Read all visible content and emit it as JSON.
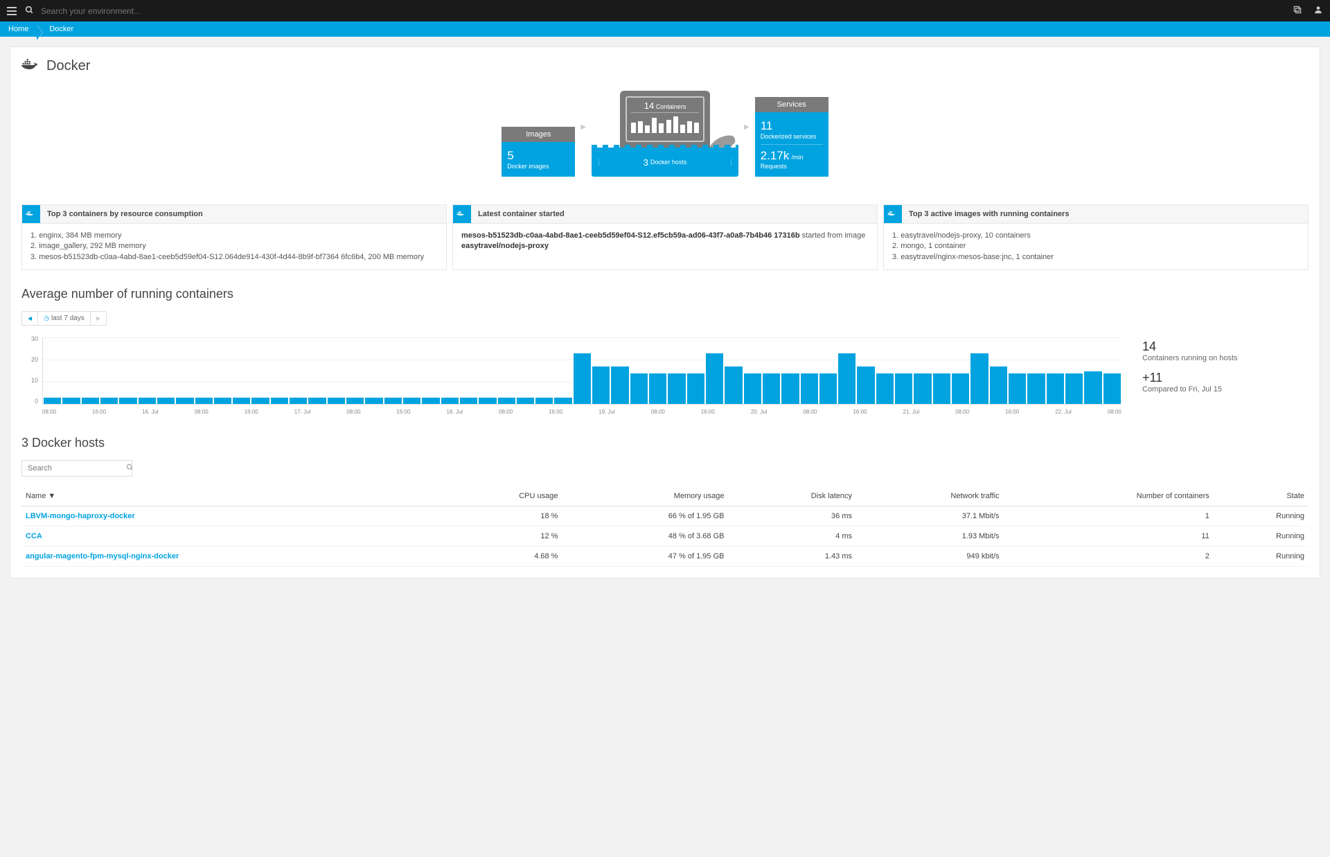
{
  "topbar": {
    "search_placeholder": "Search your environment..."
  },
  "breadcrumb": {
    "home": "Home",
    "current": "Docker"
  },
  "page": {
    "title": "Docker"
  },
  "cards": {
    "images": {
      "header": "Images",
      "count": "5",
      "label": "Docker images"
    },
    "containers": {
      "count": "14",
      "label": "Containers",
      "hosts_count": "3",
      "hosts_label": "Docker hosts"
    },
    "services": {
      "header": "Services",
      "count": "11",
      "label": "Dockerized services",
      "rate": "2.17k",
      "rate_unit": "/min",
      "rate_label": "Requests"
    }
  },
  "panels": {
    "top_containers": {
      "title": "Top 3 containers by resource consumption",
      "items": [
        "1. enginx, 384 MB memory",
        "2. image_gallery, 292 MB memory",
        "3. mesos-b51523db-c0aa-4abd-8ae1-ceeb5d59ef04-S12.064de914-430f-4d44-8b9f-bf7364 6fc6b4, 200 MB memory"
      ]
    },
    "latest": {
      "title": "Latest container started",
      "bold1": "mesos-b51523db-c0aa-4abd-8ae1-ceeb5d59ef04-S12.ef5cb59a-ad06-43f7-a0a8-7b4b46 17316b",
      "text": " started from image ",
      "bold2": "easytravel/nodejs-proxy"
    },
    "top_images": {
      "title": "Top 3 active images with running containers",
      "items": [
        "1. easytravel/nodejs-proxy, 10 containers",
        "2. mongo, 1 container",
        "3. easytravel/nginx-mesos-base:jnc, 1 container"
      ]
    }
  },
  "chart_section": {
    "title": "Average number of running containers",
    "timerange": "last 7 days",
    "summary": {
      "count": "14",
      "count_label": "Containers running on hosts",
      "delta": "+11",
      "delta_label": "Compared to Fri, Jul 15"
    }
  },
  "chart_data": {
    "type": "bar",
    "title": "Average number of running containers",
    "ylabel": "",
    "xlabel": "",
    "ylim": [
      0,
      30
    ],
    "yticks": [
      0,
      10,
      20,
      30
    ],
    "categories": [
      "08:00",
      "",
      "16:00",
      "",
      "16. Jul",
      "",
      "08:00",
      "",
      "16:00",
      "",
      "17. Jul",
      "",
      "08:00",
      "",
      "16:00",
      "",
      "18. Jul",
      "",
      "08:00",
      "",
      "16:00",
      "",
      "19. Jul",
      "",
      "08:00",
      "",
      "16:00",
      "",
      "20. Jul",
      "",
      "08:00",
      "",
      "16:00",
      "",
      "21. Jul",
      "",
      "08:00",
      "",
      "16:00",
      "",
      "22. Jul",
      "",
      "08:00"
    ],
    "x_axis_labels": [
      "08:00",
      "16:00",
      "16. Jul",
      "08:00",
      "16:00",
      "17. Jul",
      "08:00",
      "16:00",
      "18. Jul",
      "08:00",
      "16:00",
      "19. Jul",
      "08:00",
      "16:00",
      "20. Jul",
      "08:00",
      "16:00",
      "21. Jul",
      "08:00",
      "16:00",
      "22. Jul",
      "08:00"
    ],
    "values": [
      3,
      3,
      3,
      3,
      3,
      3,
      3,
      3,
      3,
      3,
      3,
      3,
      3,
      3,
      3,
      3,
      3,
      3,
      3,
      3,
      3,
      3,
      3,
      3,
      3,
      3,
      3,
      3,
      23,
      17,
      17,
      14,
      14,
      14,
      14,
      23,
      17,
      14,
      14,
      14,
      14,
      14,
      23,
      17,
      14,
      14,
      14,
      14,
      14,
      23,
      17,
      14,
      14,
      14,
      14,
      15,
      14
    ]
  },
  "hosts": {
    "title": "3 Docker hosts",
    "search_placeholder": "Search",
    "columns": [
      "Name ▼",
      "CPU usage",
      "Memory usage",
      "Disk latency",
      "Network traffic",
      "Number of containers",
      "State"
    ],
    "rows": [
      {
        "name": "LBVM-mongo-haproxy-docker",
        "cpu": "18 %",
        "mem": "66 % of 1.95 GB",
        "disk": "36 ms",
        "net": "37.1 Mbit/s",
        "cnt": "1",
        "state": "Running"
      },
      {
        "name": "CCA",
        "cpu": "12 %",
        "mem": "48 % of 3.68 GB",
        "disk": "4 ms",
        "net": "1.93 Mbit/s",
        "cnt": "11",
        "state": "Running"
      },
      {
        "name": "angular-magento-fpm-mysql-nginx-docker",
        "cpu": "4.68 %",
        "mem": "47 % of 1.95 GB",
        "disk": "1.43 ms",
        "net": "949 kbit/s",
        "cnt": "2",
        "state": "Running"
      }
    ]
  }
}
